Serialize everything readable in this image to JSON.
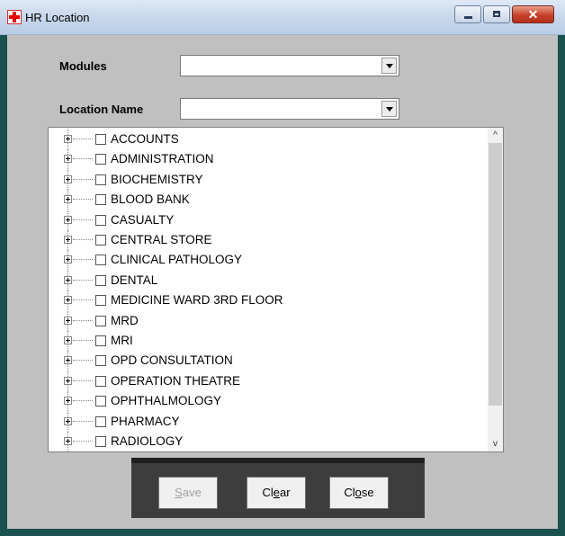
{
  "window": {
    "title": "HR Location"
  },
  "form": {
    "modules_label": "Modules",
    "modules_value": "",
    "location_label": "Location Name",
    "location_value": ""
  },
  "tree": {
    "items": [
      "ACCOUNTS",
      "ADMINISTRATION",
      "BIOCHEMISTRY",
      "BLOOD BANK",
      "CASUALTY",
      "CENTRAL STORE",
      "CLINICAL PATHOLOGY",
      "DENTAL",
      "MEDICINE WARD 3RD FLOOR",
      "MRD",
      "MRI",
      "OPD CONSULTATION",
      "OPERATION THEATRE",
      "OPHTHALMOLOGY",
      "PHARMACY",
      "RADIOLOGY"
    ]
  },
  "buttons": {
    "save_a": "S",
    "save_b": "ave",
    "clear_a": "Cl",
    "clear_u": "e",
    "clear_b": "ar",
    "close_a": "Cl",
    "close_u": "o",
    "close_b": "se"
  },
  "scrollbar": {
    "up_arrow": "^",
    "down_arrow": "v"
  }
}
